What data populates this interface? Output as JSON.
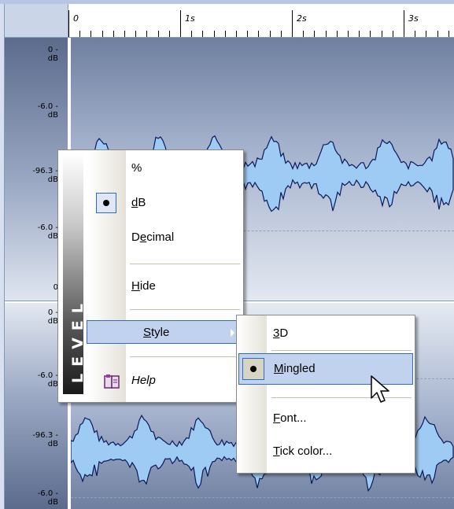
{
  "ruler": {
    "labels": [
      "0",
      "1s",
      "2s",
      "3s"
    ]
  },
  "level_scale": {
    "channel1": [
      {
        "value": "0 -",
        "unit": "dB"
      },
      {
        "value": "-6.0 -",
        "unit": "dB"
      },
      {
        "value": "-96.3 -",
        "unit": "dB"
      },
      {
        "value": "-6.0 -",
        "unit": "dB"
      },
      {
        "value": "0",
        "unit": ""
      }
    ],
    "channel2": [
      {
        "value": "0 -",
        "unit": "dB"
      },
      {
        "value": "-6.0 -",
        "unit": "dB"
      },
      {
        "value": "-96.3 -",
        "unit": "dB"
      },
      {
        "value": "-6.0 -",
        "unit": "dB"
      }
    ]
  },
  "context_menu": {
    "banner": "LEVEL",
    "items": {
      "percent": "%",
      "db_pre": "",
      "db_ul": "d",
      "db_post": "B",
      "decimal_pre": "D",
      "decimal_ul": "e",
      "decimal_post": "cimal",
      "hide_pre": "",
      "hide_ul": "H",
      "hide_post": "ide",
      "style_pre": "",
      "style_ul": "S",
      "style_post": "tyle",
      "help_pre": "",
      "help_ul": "",
      "help_post": "Help"
    }
  },
  "style_submenu": {
    "items": {
      "td_pre": "",
      "td_ul": "3",
      "td_post": "D",
      "mingled_pre": "",
      "mingled_ul": "M",
      "mingled_post": "ingled",
      "font_pre": "",
      "font_ul": "F",
      "font_post": "ont...",
      "tick_pre": "",
      "tick_ul": "T",
      "tick_post": "ick color..."
    }
  },
  "colors": {
    "selection": "#c1d2ee",
    "selection_border": "#316ac5",
    "waveform_fill": "#9ecbf3",
    "waveform_line": "#0a1a5a"
  },
  "icons": [
    "help-book-icon",
    "submenu-arrow-icon",
    "radio-bullet-icon",
    "mouse-pointer-icon"
  ]
}
